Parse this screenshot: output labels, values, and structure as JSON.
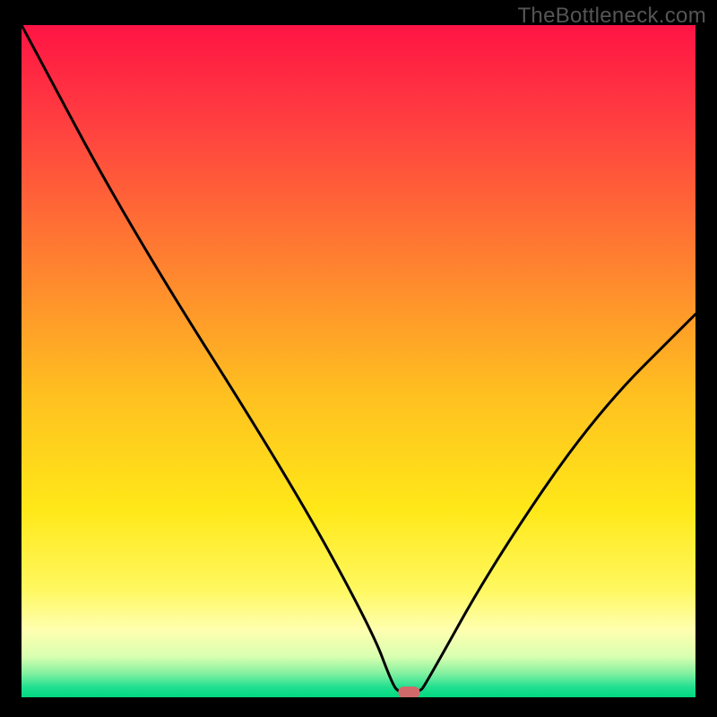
{
  "watermark": "TheBottleneck.com",
  "chart_data": {
    "type": "line",
    "title": "",
    "xlabel": "",
    "ylabel": "",
    "xlim": [
      0,
      100
    ],
    "ylim": [
      0,
      100
    ],
    "curve": {
      "name": "bottleneck-curve",
      "points": [
        {
          "x": 0,
          "y": 100
        },
        {
          "x": 16,
          "y": 70
        },
        {
          "x": 40,
          "y": 32
        },
        {
          "x": 52,
          "y": 10
        },
        {
          "x": 55,
          "y": 2
        },
        {
          "x": 56,
          "y": 0.7
        },
        {
          "x": 59,
          "y": 0.7
        },
        {
          "x": 60,
          "y": 2
        },
        {
          "x": 70,
          "y": 20
        },
        {
          "x": 85,
          "y": 42
        },
        {
          "x": 100,
          "y": 57
        }
      ]
    },
    "marker": {
      "x": 57.5,
      "y": 0.8,
      "color": "#d06a6a"
    },
    "gradient_stops": [
      {
        "offset": 0.0,
        "color": "#ff1444"
      },
      {
        "offset": 0.15,
        "color": "#ff4040"
      },
      {
        "offset": 0.35,
        "color": "#ff8030"
      },
      {
        "offset": 0.55,
        "color": "#ffc020"
      },
      {
        "offset": 0.72,
        "color": "#ffe818"
      },
      {
        "offset": 0.84,
        "color": "#fff860"
      },
      {
        "offset": 0.9,
        "color": "#ffffb0"
      },
      {
        "offset": 0.94,
        "color": "#d8ffb0"
      },
      {
        "offset": 0.965,
        "color": "#80f0a0"
      },
      {
        "offset": 0.985,
        "color": "#20e090"
      },
      {
        "offset": 1.0,
        "color": "#00d880"
      }
    ]
  }
}
